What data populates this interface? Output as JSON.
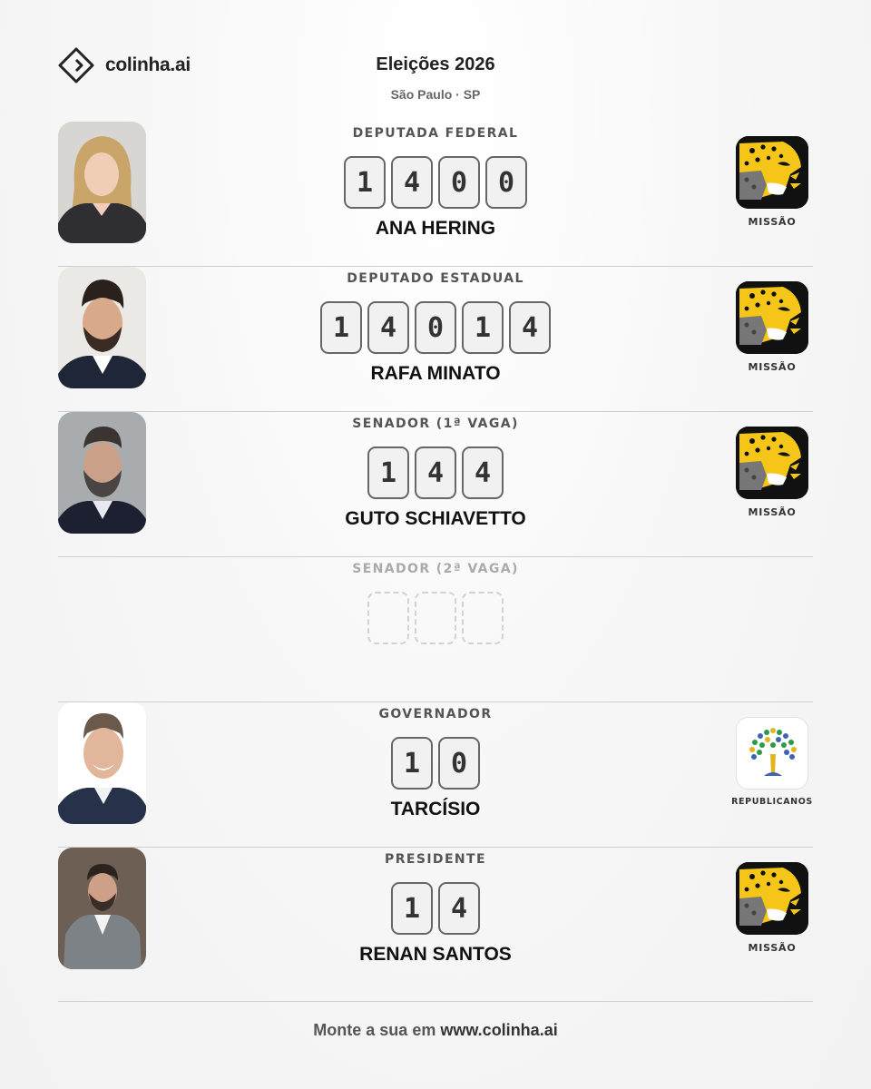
{
  "brand": {
    "name": "colinha.ai",
    "icon": "diamond-logo-icon"
  },
  "header": {
    "title": "Eleições 2026",
    "subtitle": "São Paulo · SP"
  },
  "ballot": [
    {
      "office": "DEPUTADA FEDERAL",
      "number": [
        "1",
        "4",
        "0",
        "0"
      ],
      "name": "ANA HERING",
      "party": "MISSÃO",
      "party_icon": "jaguar-icon"
    },
    {
      "office": "DEPUTADO ESTADUAL",
      "number": [
        "1",
        "4",
        "0",
        "1",
        "4"
      ],
      "name": "RAFA MINATO",
      "party": "MISSÃO",
      "party_icon": "jaguar-icon"
    },
    {
      "office": "SENADOR (1ª VAGA)",
      "number": [
        "1",
        "4",
        "4"
      ],
      "name": "GUTO SCHIAVETTO",
      "party": "MISSÃO",
      "party_icon": "jaguar-icon"
    },
    {
      "office": "SENADOR (2ª VAGA)",
      "number": [
        "",
        "",
        ""
      ],
      "name": "",
      "party": "",
      "empty": true
    },
    {
      "office": "GOVERNADOR",
      "number": [
        "1",
        "0"
      ],
      "name": "TARCÍSIO",
      "party": "REPUBLICANOS",
      "party_icon": "tree-icon"
    },
    {
      "office": "PRESIDENTE",
      "number": [
        "1",
        "4"
      ],
      "name": "RENAN SANTOS",
      "party": "MISSÃO",
      "party_icon": "jaguar-icon"
    }
  ],
  "footer": {
    "prefix": "Monte a sua em ",
    "link": "www.colinha.ai"
  },
  "colors": {
    "jaguar_yellow": "#f5c518",
    "logo_black": "#111111",
    "divider": "#cfcfcf",
    "digit_border": "#666666"
  }
}
